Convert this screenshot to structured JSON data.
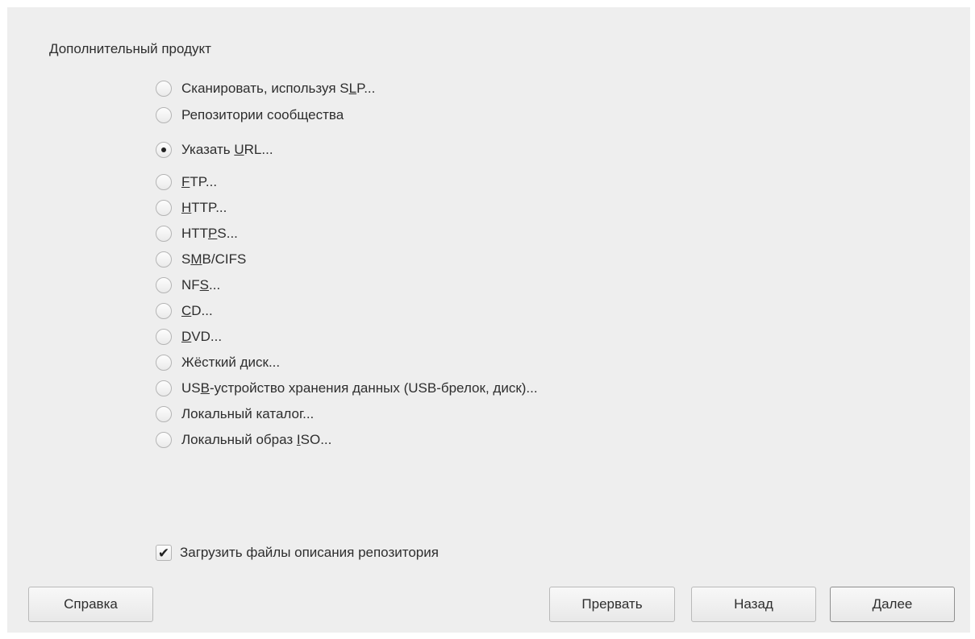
{
  "dialog": {
    "section_title": "Дополнительный продукт",
    "options": [
      {
        "pre": "Сканировать, используя S",
        "mn": "L",
        "post": "P...",
        "checked": false
      },
      {
        "pre": "Репозитории сообщества",
        "mn": "",
        "post": "",
        "checked": false
      },
      {
        "pre": "Указать ",
        "mn": "U",
        "post": "RL...",
        "checked": true
      },
      {
        "pre": "",
        "mn": "F",
        "post": "TP...",
        "checked": false
      },
      {
        "pre": "",
        "mn": "H",
        "post": "TTP...",
        "checked": false
      },
      {
        "pre": "HTT",
        "mn": "P",
        "post": "S...",
        "checked": false
      },
      {
        "pre": "S",
        "mn": "M",
        "post": "B/CIFS",
        "checked": false
      },
      {
        "pre": "NF",
        "mn": "S",
        "post": "...",
        "checked": false
      },
      {
        "pre": "",
        "mn": "C",
        "post": "D...",
        "checked": false
      },
      {
        "pre": "",
        "mn": "D",
        "post": "VD...",
        "checked": false
      },
      {
        "pre": "Жёсткий диск...",
        "mn": "",
        "post": "",
        "checked": false
      },
      {
        "pre": "US",
        "mn": "B",
        "post": "-устройство хранения данных (USB-брелок, диск)...",
        "checked": false
      },
      {
        "pre": "Локальный каталог...",
        "mn": "",
        "post": "",
        "checked": false
      },
      {
        "pre": "Локальный образ ",
        "mn": "I",
        "post": "SO...",
        "checked": false
      }
    ],
    "download_checkbox": {
      "label": "Загрузить файлы описания репозитория",
      "checked": true
    }
  },
  "buttons": {
    "help": "Справка",
    "abort": "Прервать",
    "back": "Назад",
    "next": "Далее"
  }
}
